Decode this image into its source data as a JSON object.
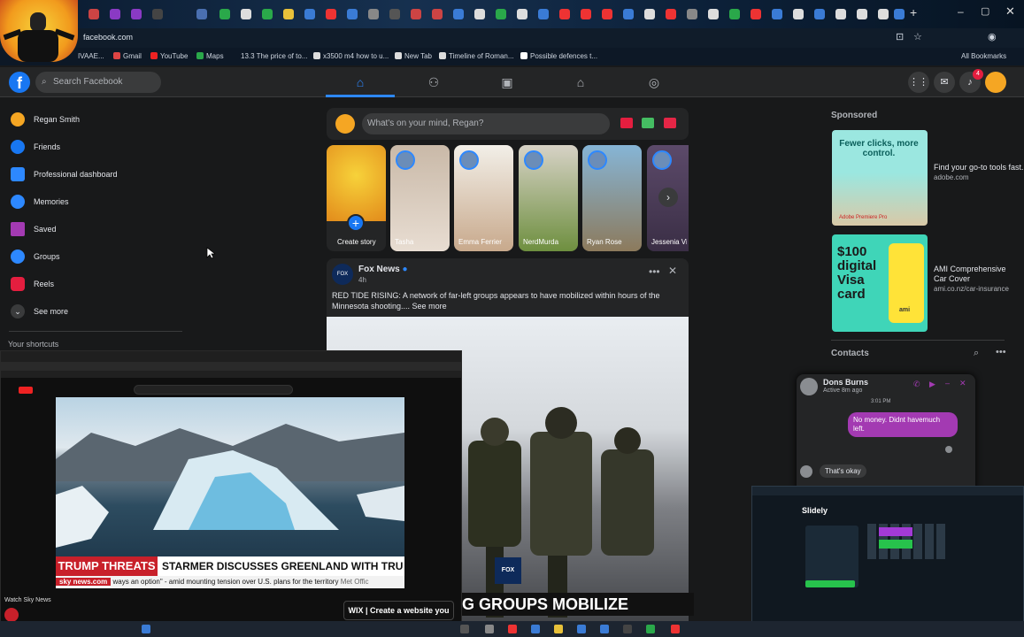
{
  "browser": {
    "address": "facebook.com",
    "bookmarks": [
      "IVAAE...",
      "Gmail",
      "YouTube",
      "Maps",
      "13.3 The price of to...",
      "x3500 m4 how to u...",
      "New Tab",
      "Timeline of Roman...",
      "Possible defences t...",
      "All Bookmarks"
    ]
  },
  "header": {
    "search_placeholder": "Search Facebook",
    "notif_count": "4"
  },
  "sidebar": {
    "items": [
      {
        "label": "Regan Smith",
        "color": "#f5a623"
      },
      {
        "label": "Friends",
        "color": "#1877f2"
      },
      {
        "label": "Professional dashboard",
        "color": "#2d88ff"
      },
      {
        "label": "Memories",
        "color": "#2d88ff"
      },
      {
        "label": "Saved",
        "color": "#a33ab2"
      },
      {
        "label": "Groups",
        "color": "#2d88ff"
      },
      {
        "label": "Reels",
        "color": "#e41e3f"
      },
      {
        "label": "See more",
        "color": "#3a3b3c"
      }
    ],
    "shortcuts_heading": "Your shortcuts"
  },
  "composer": {
    "placeholder": "What's on your mind, Regan?"
  },
  "stories": [
    {
      "label": "Create story"
    },
    {
      "label": "Tasha"
    },
    {
      "label": "Emma Ferrier"
    },
    {
      "label": "NerdMurda"
    },
    {
      "label": "Ryan Rose"
    },
    {
      "label": "Jessenia Vi"
    }
  ],
  "post": {
    "author": "Fox News",
    "time": "4h",
    "text": "RED TIDE RISING: A network of far-left groups appears to have mobilized within hours of the Minnesota shooting.... See more",
    "image_caption": "G GROUPS MOBILIZE",
    "logo": "FOX NEWS"
  },
  "right": {
    "sponsored_heading": "Sponsored",
    "ads": [
      {
        "image_text": "Fewer clicks, more control.",
        "brand": "Adobe Premiere Pro",
        "title": "Find your go-to tools fast.",
        "domain": "adobe.com"
      },
      {
        "image_text": "$100 digital Visa card",
        "brand": "ami",
        "title": "AMI Comprehensive Car Cover",
        "domain": "ami.co.nz/car-insurance"
      }
    ],
    "contacts_heading": "Contacts"
  },
  "chat": {
    "name": "Dons Burns",
    "status": "Active 8m ago",
    "time": "3:01 PM",
    "outgoing": "No money. Didnt havemuch left.",
    "incoming": "That's okay"
  },
  "youtube": {
    "banner_left": "TRUMP THREATS",
    "banner_right": "STARMER DISCUSSES GREENLAND WITH TRUMP",
    "ticker_source": "sky news.com",
    "ticker_text": "ways an option\" - amid mounting tension over U.S. plans for the territory",
    "ticker_extra": "Met Offic",
    "channel_label": "Watch Sky News",
    "wix_ad": "WIX | Create a website you"
  },
  "slidely": {
    "title": "Slidely"
  }
}
